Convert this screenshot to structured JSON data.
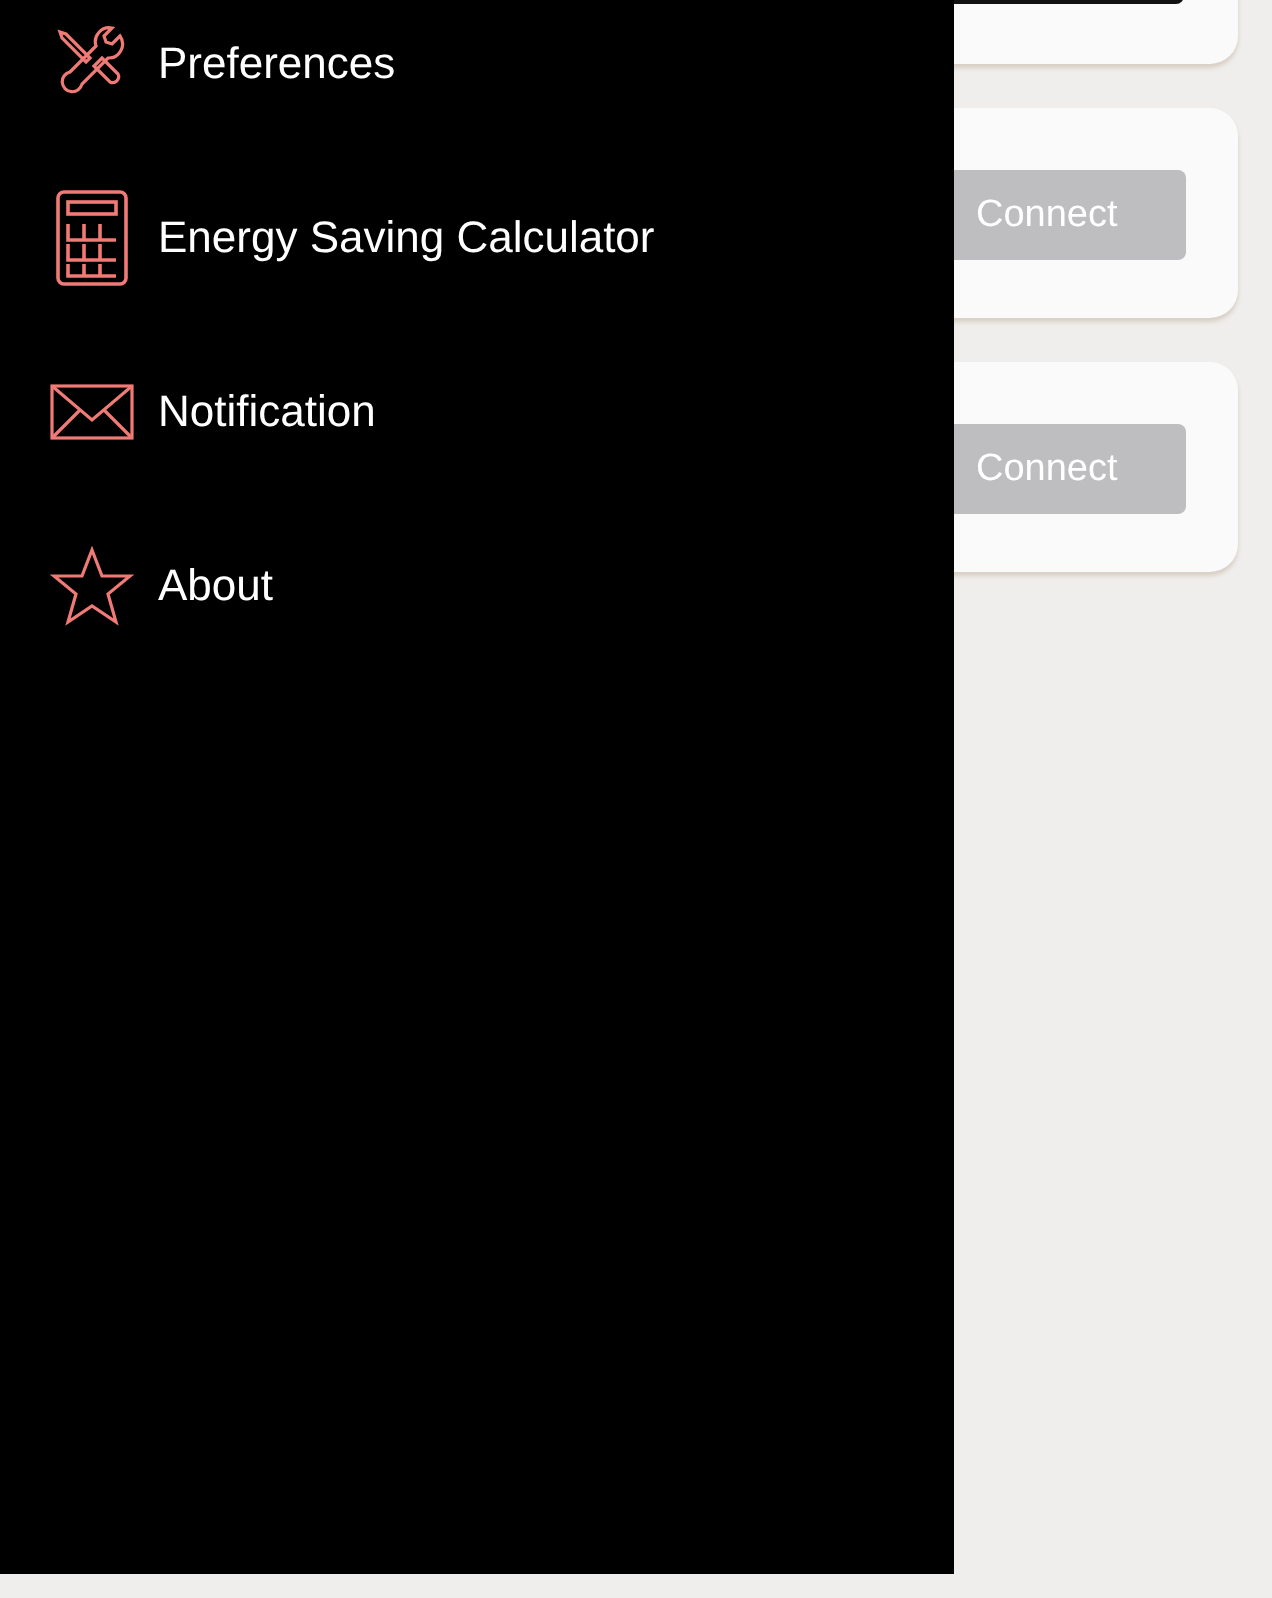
{
  "drawer": {
    "items": [
      {
        "label": "Preferences"
      },
      {
        "label": "Energy Saving Calculator"
      },
      {
        "label": "Notification"
      },
      {
        "label": "About"
      }
    ]
  },
  "cards": [
    {
      "kind": "dark-button"
    },
    {
      "kind": "connect",
      "button": "Connect"
    },
    {
      "kind": "connect",
      "button": "Connect"
    }
  ]
}
